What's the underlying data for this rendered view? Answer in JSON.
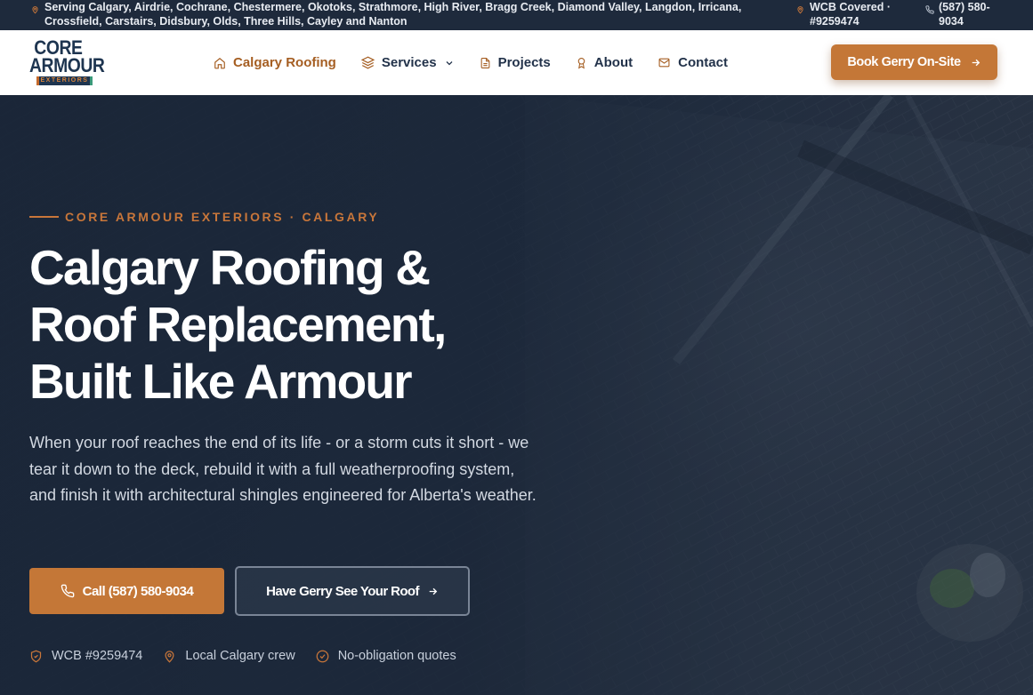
{
  "topbar": {
    "service_areas": "Serving Calgary, Airdrie, Cochrane, Chestermere, Okotoks, Strathmore, High River, Bragg Creek, Diamond Valley, Langdon, Irricana, Crossfield, Carstairs, Didsbury, Olds, Three Hills, Cayley and Nanton",
    "wcb_line1": "WCB Covered ·",
    "wcb_line2": "#9259474",
    "phone_line1": "(587) 580-",
    "phone_line2": "9034"
  },
  "logo": {
    "line1": "CORE",
    "line2": "ARMOUR",
    "line3": "EXTERIORS"
  },
  "nav": {
    "items": [
      {
        "label": "Calgary Roofing",
        "icon": "home-icon"
      },
      {
        "label": "Services",
        "icon": "layers-icon"
      },
      {
        "label": "Projects",
        "icon": "document-icon"
      },
      {
        "label": "About",
        "icon": "award-icon"
      },
      {
        "label": "Contact",
        "icon": "mail-icon"
      }
    ],
    "cta": "Book Gerry On-Site"
  },
  "hero": {
    "eyebrow": "CORE ARMOUR EXTERIORS · CALGARY",
    "title_line1": "Calgary Roofing &",
    "title_line2": "Roof Replacement,",
    "title_line3": "Built Like Armour",
    "lead": "When your roof reaches the end of its life - or a storm cuts it short - we tear it down to the deck, rebuild it with a full weatherproofing system, and finish it with architectural shingles engineered for Alberta's weather.",
    "call_button": "Call (587) 580-9034",
    "see_button": "Have Gerry See Your Roof",
    "badges": [
      {
        "label": "WCB #9259474",
        "icon": "shield-icon"
      },
      {
        "label": "Local Calgary crew",
        "icon": "map-pin-icon"
      },
      {
        "label": "No-obligation quotes",
        "icon": "check-circle-icon"
      }
    ]
  },
  "colors": {
    "accent": "#c47737",
    "navy": "#1e2a3c",
    "nav_text": "#22324a"
  }
}
